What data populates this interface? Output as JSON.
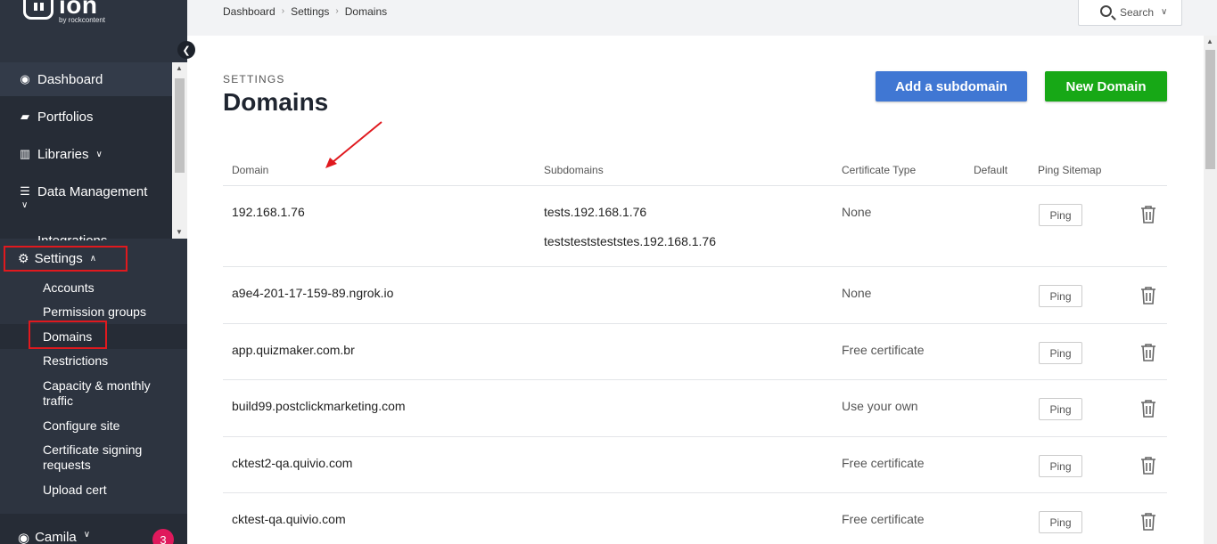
{
  "brand": {
    "name": "ion",
    "byline": "by rockcontent"
  },
  "sidebar": {
    "collapse_icon": "chevron-left-icon",
    "nav": [
      {
        "label": "Dashboard",
        "icon": "user-circle-icon"
      },
      {
        "label": "Portfolios",
        "icon": "folder-icon"
      },
      {
        "label": "Libraries",
        "icon": "books-icon"
      },
      {
        "label": "Data Management",
        "icon": "database-icon"
      },
      {
        "label": "Integrations",
        "icon": "plug-icon"
      }
    ],
    "settings": {
      "label": "Settings",
      "icon": "gear-icon"
    },
    "settings_items": [
      "Accounts",
      "Permission groups",
      "Domains",
      "Restrictions",
      "Capacity & monthly traffic",
      "Configure site",
      "Certificate signing requests",
      "Upload cert"
    ],
    "user": {
      "label": "Camila",
      "badge": "3"
    }
  },
  "topbar": {
    "breadcrumb": [
      "Dashboard",
      "Settings",
      "Domains"
    ],
    "search_label": "Search"
  },
  "page": {
    "section": "SETTINGS",
    "title": "Domains",
    "add_subdomain_label": "Add a subdomain",
    "new_domain_label": "New Domain"
  },
  "table": {
    "headers": {
      "domain": "Domain",
      "subdomains": "Subdomains",
      "certificate": "Certificate Type",
      "default": "Default",
      "ping": "Ping Sitemap"
    },
    "ping_label": "Ping",
    "rows": [
      {
        "domain": "192.168.1.76",
        "subdomains": [
          "tests.192.168.1.76",
          "teststeststeststes.192.168.1.76"
        ],
        "certificate": "None"
      },
      {
        "domain": "a9e4-201-17-159-89.ngrok.io",
        "subdomains": [],
        "certificate": "None"
      },
      {
        "domain": "app.quizmaker.com.br",
        "subdomains": [],
        "certificate": "Free certificate"
      },
      {
        "domain": "build99.postclickmarketing.com",
        "subdomains": [],
        "certificate": "Use your own"
      },
      {
        "domain": "cktest2-qa.quivio.com",
        "subdomains": [],
        "certificate": "Free certificate"
      },
      {
        "domain": "cktest-qa.quivio.com",
        "subdomains": [],
        "certificate": "Free certificate"
      }
    ]
  },
  "colors": {
    "sidebar_bg": "#2d3440",
    "primary_blue": "#4077d3",
    "success_green": "#17a816",
    "highlight_red": "#e0191e",
    "badge_pink": "#e0195c"
  }
}
